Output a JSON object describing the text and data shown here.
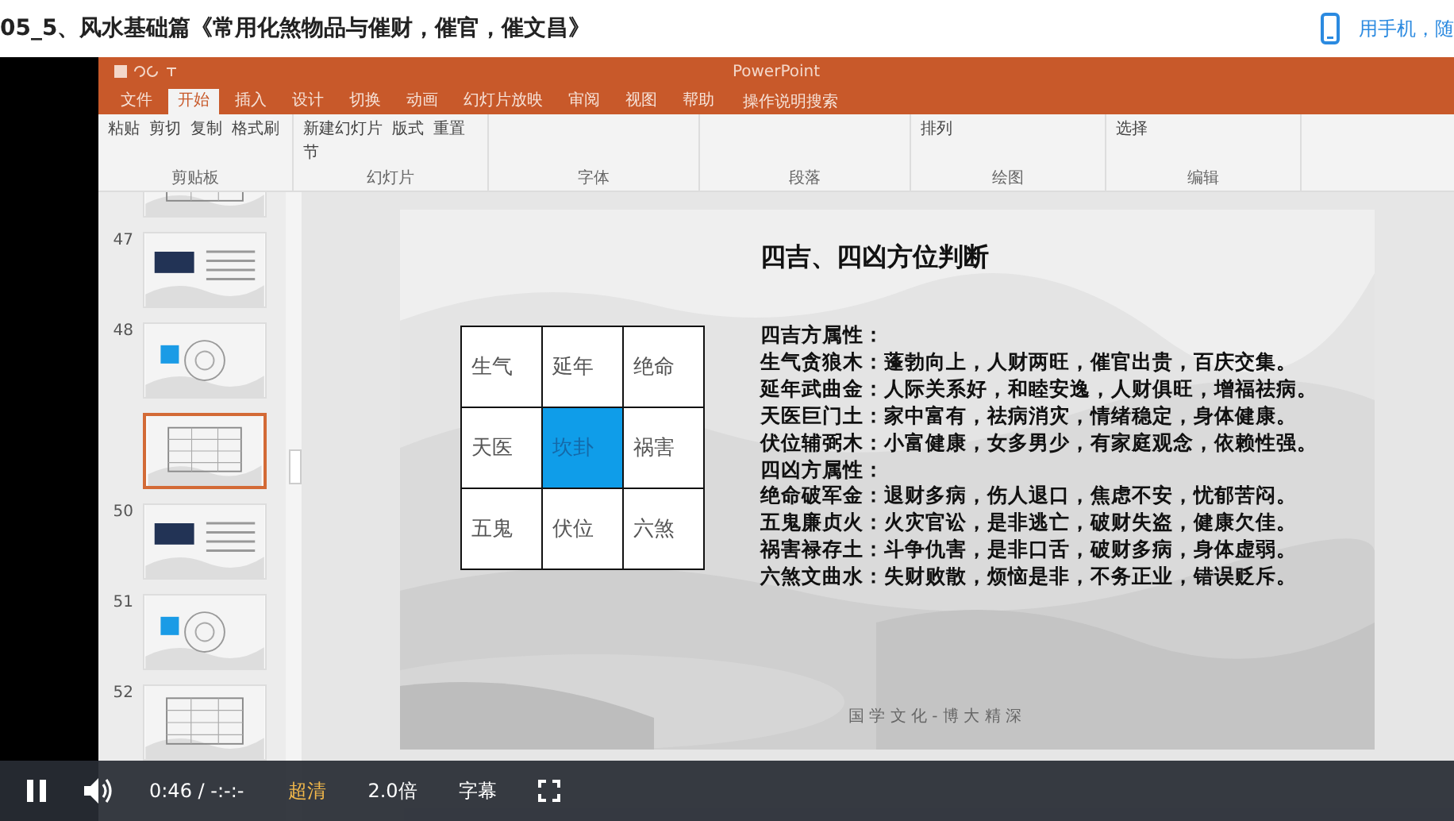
{
  "page_title": "05_5、风水基础篇《常用化煞物品与催财，催官，催文昌》",
  "mobile_link": "用手机，随",
  "app": {
    "title": "PowerPoint",
    "tabs": [
      {
        "label": "文件",
        "selected": false
      },
      {
        "label": "开始",
        "selected": true
      },
      {
        "label": "插入",
        "selected": false
      },
      {
        "label": "设计",
        "selected": false
      },
      {
        "label": "切换",
        "selected": false
      },
      {
        "label": "动画",
        "selected": false
      },
      {
        "label": "幻灯片放映",
        "selected": false
      },
      {
        "label": "审阅",
        "selected": false
      },
      {
        "label": "视图",
        "selected": false
      },
      {
        "label": "帮助",
        "selected": false
      }
    ],
    "search": "操作说明搜索",
    "ribbon_groups": [
      {
        "label": "剪贴板",
        "buttons": [
          "粘贴",
          "剪切",
          "复制",
          "格式刷"
        ]
      },
      {
        "label": "幻灯片",
        "buttons": [
          "新建幻灯片",
          "版式",
          "重置",
          "节"
        ]
      },
      {
        "label": "字体"
      },
      {
        "label": "段落"
      },
      {
        "label": "绘图",
        "buttons": [
          "排列"
        ]
      },
      {
        "label": "编辑",
        "buttons": [
          "选择"
        ]
      }
    ],
    "thumbnails": [
      {
        "selected": false
      },
      {
        "number": "47",
        "selected": false
      },
      {
        "number": "48",
        "selected": false
      },
      {
        "selected": true
      },
      {
        "number": "50",
        "selected": false
      },
      {
        "number": "51",
        "selected": false
      },
      {
        "number": "52",
        "selected": false
      }
    ],
    "slide": {
      "heading": "四吉、四凶方位判断",
      "grid": [
        {
          "label": "生气",
          "selected": false
        },
        {
          "label": "延年",
          "selected": false
        },
        {
          "label": "绝命",
          "selected": false
        },
        {
          "label": "天医",
          "selected": false
        },
        {
          "label": "坎卦",
          "selected": true
        },
        {
          "label": "祸害",
          "selected": false
        },
        {
          "label": "五鬼",
          "selected": false
        },
        {
          "label": "伏位",
          "selected": false
        },
        {
          "label": "六煞",
          "selected": false
        }
      ],
      "lines": [
        "四吉方属性：",
        "生气贪狼木：蓬勃向上，人财两旺，催官出贵，百庆交集。",
        "延年武曲金：人际关系好，和睦安逸，人财俱旺，增福祛病。",
        "天医巨门土：家中富有，祛病消灾，情绪稳定，身体健康。",
        "伏位辅弼木：小富健康，女多男少，有家庭观念，依赖性强。",
        "四凶方属性：",
        "绝命破军金：退财多病，伤人退口，焦虑不安，忧郁苦闷。",
        "五鬼廉贞火：火灾官讼，是非逃亡，破财失盗，健康欠佳。",
        "祸害禄存土：斗争仇害，是非口舌，破财多病，身体虚弱。",
        "六煞文曲水：失财败散，烦恼是非，不务正业，错误贬斥。"
      ],
      "footer": "国 学 文 化 - 博 大 精 深"
    }
  },
  "player": {
    "playing": true,
    "time": "0:46 / -:-:-",
    "quality": "超清",
    "speed": "2.0倍",
    "subtitles": "字幕"
  }
}
